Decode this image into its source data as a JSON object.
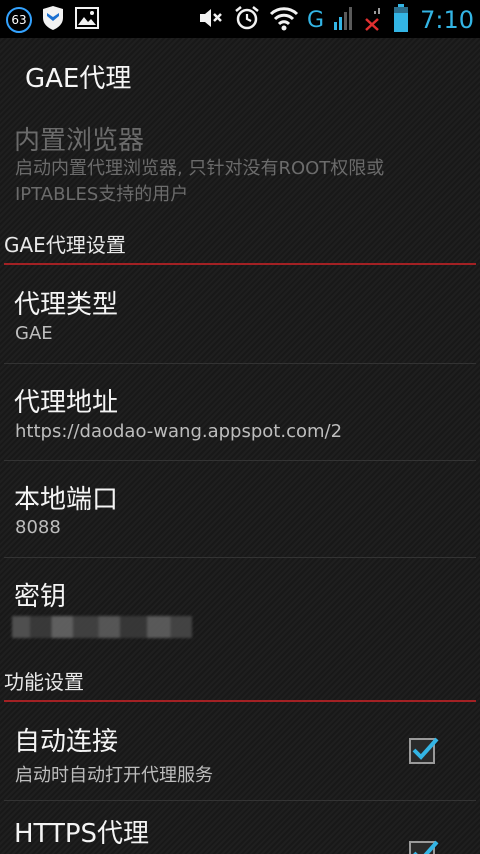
{
  "status_bar": {
    "notification_count": "63",
    "time": "7:10",
    "network_type": "G",
    "icons": [
      "shield-icon",
      "gallery-icon",
      "mute-icon",
      "alarm-icon",
      "wifi-icon",
      "signal-icon",
      "no-signal-icon",
      "battery-icon"
    ]
  },
  "action_bar": {
    "title": "GAE代理"
  },
  "prefs": {
    "builtin_browser": {
      "title": "内置浏览器",
      "summary": "启动内置代理浏览器, 只针对没有ROOT权限或IPTABLES支持的用户"
    },
    "gae_header": "GAE代理设置",
    "proxy_type": {
      "title": "代理类型",
      "value": "GAE"
    },
    "proxy_address": {
      "title": "代理地址",
      "value": "https://daodao-wang.appspot.com/2"
    },
    "local_port": {
      "title": "本地端口",
      "value": "8088"
    },
    "secret_key": {
      "title": "密钥"
    },
    "function_header": "功能设置",
    "auto_connect": {
      "title": "自动连接",
      "summary": "启动时自动打开代理服务",
      "checked": true
    },
    "https_proxy": {
      "title": "HTTPS代理",
      "checked": true
    }
  },
  "colors": {
    "accent": "#33b5e5",
    "category_line": "#a32124",
    "status_bar_bg": "#000000"
  }
}
